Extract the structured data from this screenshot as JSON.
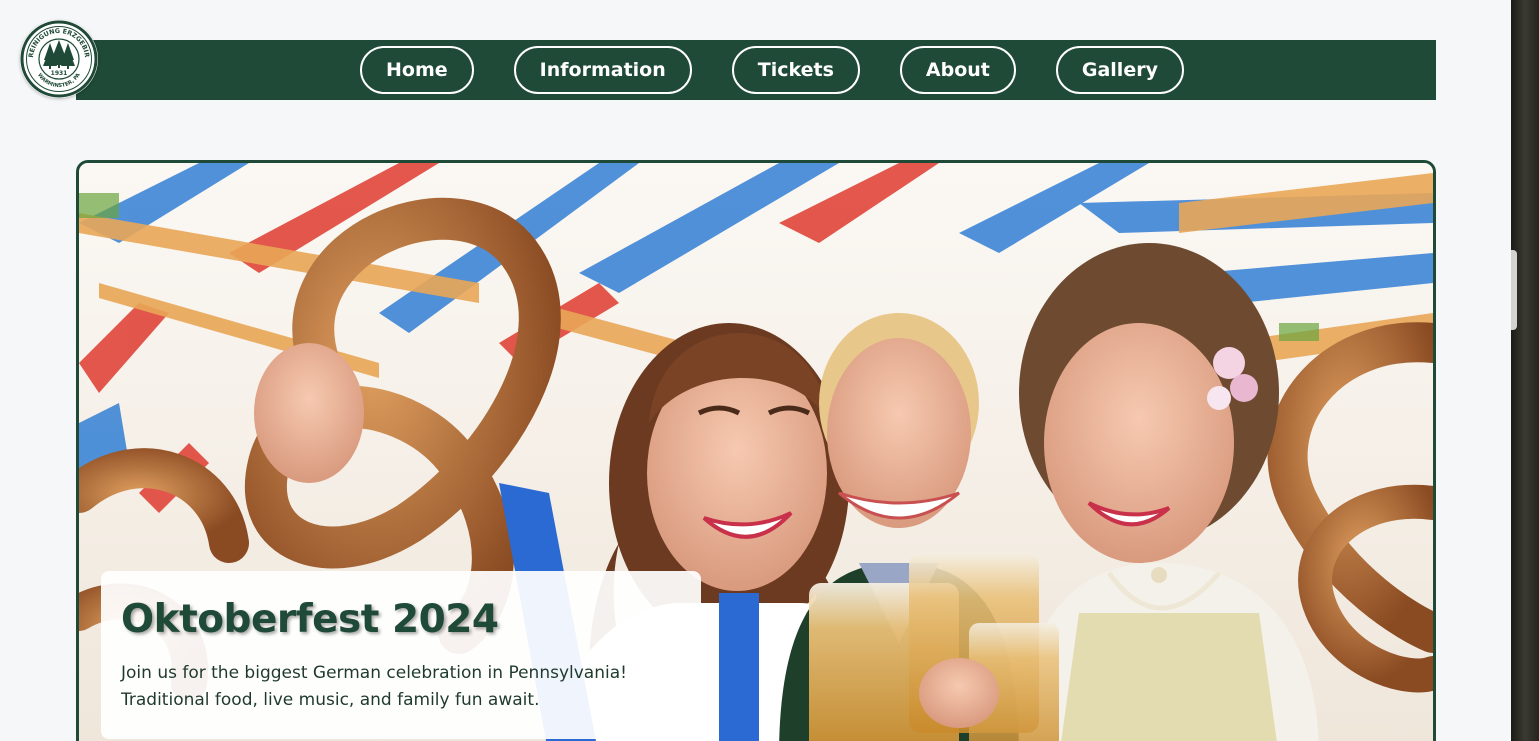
{
  "logo": {
    "arc_top": "VEREINIGUNG ERZGEBIRGE",
    "year": "1931",
    "arc_bottom": "WARMINSTER, PA"
  },
  "nav": {
    "items": [
      {
        "label": "Home"
      },
      {
        "label": "Information"
      },
      {
        "label": "Tickets"
      },
      {
        "label": "About"
      },
      {
        "label": "Gallery"
      }
    ]
  },
  "hero": {
    "title": "Oktoberfest 2024",
    "description_line1": "Join us for the biggest German celebration in Pennsylvania!",
    "description_line2": "Traditional food, live music, and family fun await."
  },
  "colors": {
    "brand_green": "#1f4a37",
    "page_background": "#f6f7f9",
    "nav_text": "#ffffff"
  }
}
